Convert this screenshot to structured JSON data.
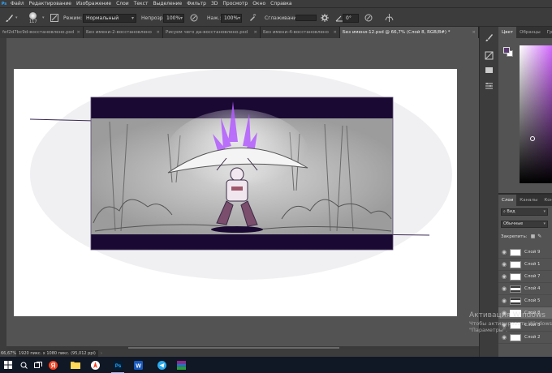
{
  "menu": [
    "Ps",
    "Файл",
    "Редактирование",
    "Изображение",
    "Слои",
    "Текст",
    "Выделение",
    "Фильтр",
    "3D",
    "Просмотр",
    "Окно",
    "Справка"
  ],
  "options": {
    "brush_size": "117",
    "mode_label": "Режим:",
    "mode_value": "Нормальный",
    "opacity_label": "Непрозр.:",
    "opacity_value": "100%",
    "pressure_label": "Наж.:",
    "pressure_value": "100%",
    "smoothing_label": "Сглаживание:",
    "angle_value": "0°"
  },
  "tabs": [
    {
      "label": "fef2d7bc9d-восстановлено.psd",
      "active": false
    },
    {
      "label": "Без имени-2-восстановлено",
      "active": false
    },
    {
      "label": "Рисуем чего да-восстановлено.psd",
      "active": false
    },
    {
      "label": "Без имени-4-восстановлено",
      "active": false
    },
    {
      "label": "Без имени-12.psd @ 66,7% (Слой 8, RGB/8#) *",
      "active": true
    }
  ],
  "status": {
    "zoom": "66,67%",
    "doc_info": "1920 пикс. x 1080 пикс. (95,012 ppi)"
  },
  "color_panel": {
    "tabs": [
      "Цвет",
      "Образцы",
      "Гра"
    ],
    "fg_color": "#5a3a70",
    "bg_color": "#ffffff"
  },
  "layers_panel": {
    "tabs": [
      "Слои",
      "Каналы",
      "Конт"
    ],
    "search": "Вид",
    "blend": "Обычные",
    "lock_label": "Закрепить:",
    "layers": [
      {
        "name": "Слой 9",
        "active": false
      },
      {
        "name": "Слой 1",
        "active": false
      },
      {
        "name": "Слой 7",
        "active": false
      },
      {
        "name": "Слой 4",
        "active": false
      },
      {
        "name": "Слой 5",
        "active": false
      },
      {
        "name": "Слой 8",
        "active": true
      },
      {
        "name": "Слой 3",
        "active": false
      },
      {
        "name": "Слой 2",
        "active": false
      }
    ]
  },
  "activation": {
    "title": "Активация Windows",
    "subtitle": "Чтобы активировать Windows,",
    "subtitle2": "\"Параметры\"."
  },
  "taskbar": {
    "apps": [
      "start-icon",
      "search-icon",
      "task-view-icon",
      "yandex-icon",
      "file-explorer-icon",
      "yandex-browser-icon",
      "photoshop-icon",
      "word-icon",
      "telegram-icon",
      "winrar-icon"
    ],
    "ps_label": "Ps",
    "word_label": "W"
  },
  "accent": "#31a8ff"
}
